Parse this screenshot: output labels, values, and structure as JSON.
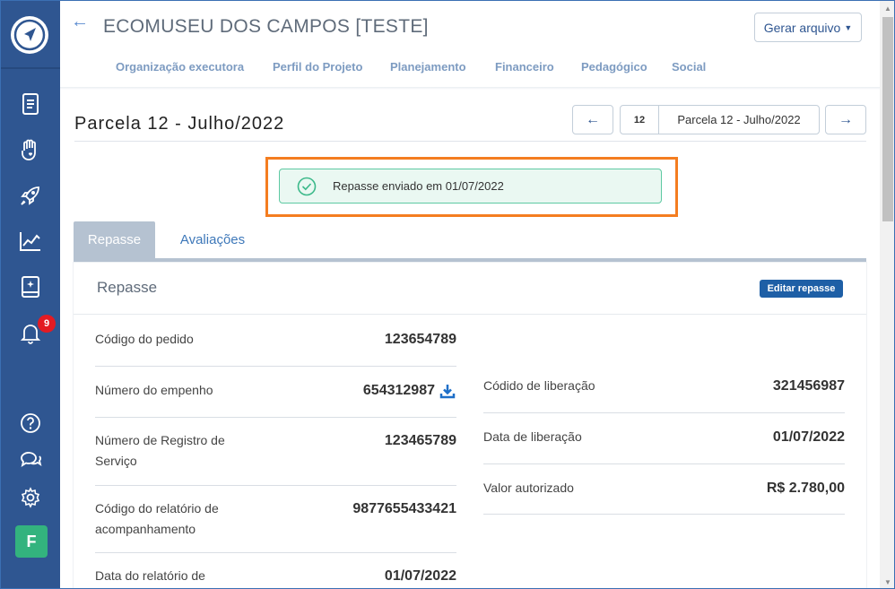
{
  "header": {
    "title": "ECOMUSEU DOS CAMPOS [TESTE]",
    "generate_button": "Gerar arquivo",
    "tabs": [
      "Organização executora",
      "Perfil do Projeto",
      "Planejamento",
      "Financeiro",
      "Pedagógico",
      "Social"
    ]
  },
  "sidebar": {
    "notification_count": "9",
    "avatar_initial": "F"
  },
  "parcela": {
    "title": "Parcela 12 - Julho/2022",
    "number": "12",
    "selected": "Parcela 12 - Julho/2022",
    "prev_arrow": "←",
    "next_arrow": "→"
  },
  "status": {
    "message": "Repasse enviado em 01/07/2022"
  },
  "tabs": {
    "repasse": "Repasse",
    "avaliacoes": "Avaliações"
  },
  "card": {
    "title": "Repasse",
    "edit_button": "Editar repasse",
    "left": [
      {
        "label": "Código do pedido",
        "value": "123654789"
      },
      {
        "label": "Número do empenho",
        "value": "654312987"
      },
      {
        "label": "Número de Registro de Serviço",
        "value": "123465789"
      },
      {
        "label": "Código do relatório de acompanhamento",
        "value": "9877655433421"
      },
      {
        "label": "Data do relatório de",
        "value": "01/07/2022"
      }
    ],
    "right": [
      {
        "label": "Códido de liberação",
        "value": "321456987"
      },
      {
        "label": "Data de liberação",
        "value": "01/07/2022"
      },
      {
        "label": "Valor autorizado",
        "value": "R$ 2.780,00"
      }
    ]
  },
  "colors": {
    "sidebar": "#2f5691",
    "accent": "#1e5fa6",
    "highlight": "#f47d20",
    "success": "#5ec9a2"
  }
}
